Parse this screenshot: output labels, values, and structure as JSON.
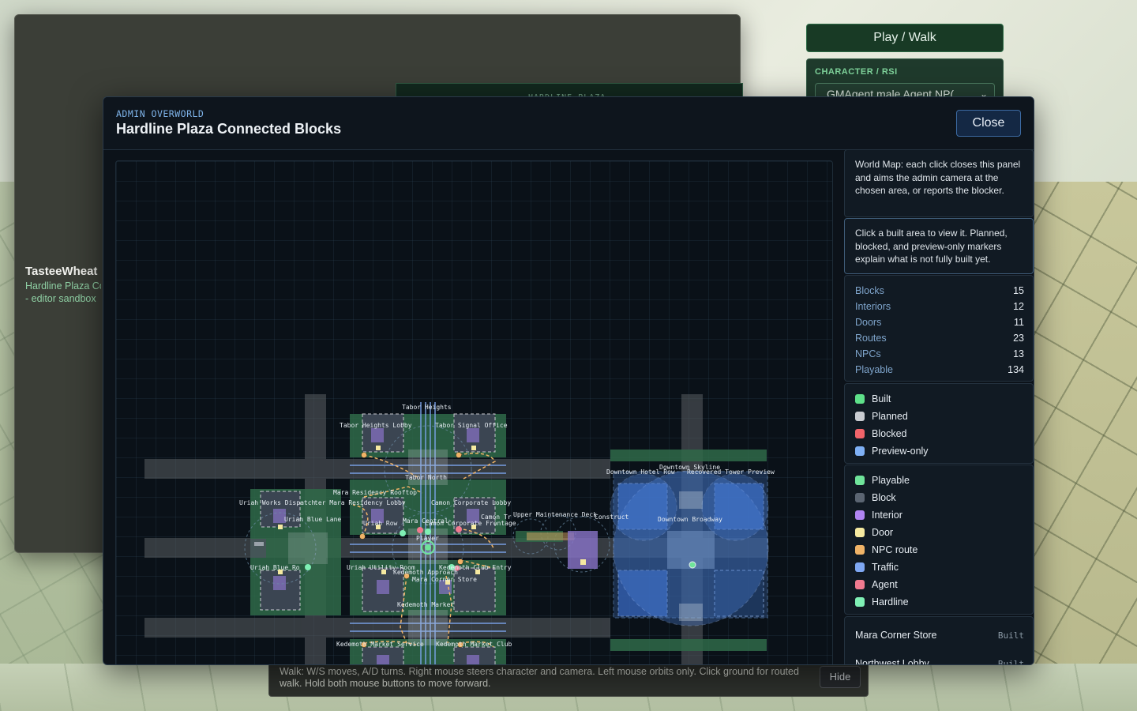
{
  "background": {
    "panel_title": "HARDLINE PLAZA",
    "user_name": "TasteeWheat",
    "user_sub": "Hardline Plaza Co",
    "user_sub2": "- editor sandbox",
    "play_walk_label": "Play / Walk",
    "character_label": "CHARACTER / RSI",
    "character_value": "GMAgent male Agent NP(",
    "walk_help": "Walk: W/S moves, A/D turns. Right mouse steers character and camera. Left mouse orbits only. Click ground for routed walk. Hold both mouse buttons to move forward.",
    "hide_label": "Hide"
  },
  "modal": {
    "eyebrow": "ADMIN OVERWORLD",
    "title": "Hardline Plaza Connected Blocks",
    "close_label": "Close"
  },
  "sidebar": {
    "world_map_note": "World Map: each click closes this panel and aims the admin camera at the chosen area, or reports the blocker.",
    "hint_note": "Click a built area to view it. Planned, blocked, and preview-only markers explain what is not fully built yet.",
    "stats": [
      {
        "label": "Blocks",
        "value": "15"
      },
      {
        "label": "Interiors",
        "value": "12"
      },
      {
        "label": "Doors",
        "value": "11"
      },
      {
        "label": "Routes",
        "value": "23"
      },
      {
        "label": "NPCs",
        "value": "13"
      },
      {
        "label": "Playable",
        "value": "134"
      }
    ],
    "status_legend": [
      {
        "label": "Built",
        "color": "#5ee089"
      },
      {
        "label": "Planned",
        "color": "#c9ccd1"
      },
      {
        "label": "Blocked",
        "color": "#f2646a"
      },
      {
        "label": "Preview-only",
        "color": "#7fb0f5"
      }
    ],
    "layer_legend": [
      {
        "label": "Playable",
        "color": "#6fe39a"
      },
      {
        "label": "Block",
        "color": "#5b6572"
      },
      {
        "label": "Interior",
        "color": "#b084f2"
      },
      {
        "label": "Door",
        "color": "#f5e9a0"
      },
      {
        "label": "NPC route",
        "color": "#f0b367"
      },
      {
        "label": "Traffic",
        "color": "#7fa7f2"
      },
      {
        "label": "Agent",
        "color": "#f07a8f"
      },
      {
        "label": "Hardline",
        "color": "#7ff0b5"
      }
    ],
    "areas": [
      {
        "name": "Mara Corner Store",
        "status": "Built"
      },
      {
        "name": "Northwest Lobby",
        "status": "Built"
      }
    ]
  },
  "map": {
    "labels": {
      "tabor_heights": "Tabor Heights",
      "tabor_heights_lobby": "Tabor Heights Lobby",
      "tabor_signal_office": "Tabor Signal Office",
      "tabor_north": "Tabor North",
      "mara_residency_rooftop": "Mara Residency Rooftop",
      "uriah_works_dispatch": "Uriah Works Dispatch",
      "mara_residency_lobby": "ter Mara Residency Lobby",
      "camon_corporate_lobby": "Camon Corporate Lobby",
      "uriah_blue_lane": "Uriah Blue Lane",
      "uriah_row": "Uriah Row",
      "mara_central": "Mara Central",
      "camon_corporate_frontage": "Camon Corporate Frontage",
      "camon_transit": "Camon Tr",
      "upper_maintenance_deck": "Upper Maintenance Deck",
      "construct": "Construct",
      "player": "Player",
      "uriah_blue_row": "Uriah Blue Ro",
      "uriah_utility_room": "Uriah Utility Room",
      "kedemoth_approach": "Kedemoth Approach",
      "kedemoth_club_entry": "Kedemoth Club Entry",
      "mara_corner_store": "Mara Corner Store",
      "kedemoth_market": "Kedemoth Market",
      "kedemoth_market_service": "Kedemoth Market Service",
      "kedemoth_market_club": "Kedemoth Market Club",
      "downtown_skyline": "Downtown Skyline",
      "downtown_hotel_row": "Downtown Hotel Row",
      "recovered_tower_preview": "Recovered Tower Preview",
      "downtown_broadway": "Downtown Broadway"
    }
  }
}
